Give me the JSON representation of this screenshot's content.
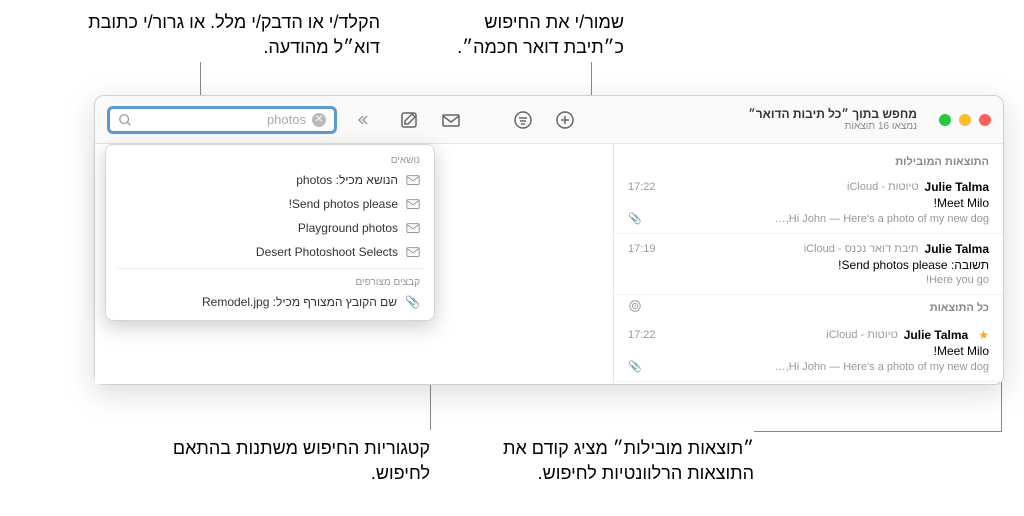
{
  "callouts": {
    "top_left": "הקלד/י או הדבק/י מלל. או גרור/י כתובת דוא״ל מהודעה.",
    "top_right": "שמור/י את החיפוש כ״תיבת דואר חכמה״.",
    "bottom_left": "קטגוריות החיפוש משתנות בהתאם לחיפוש.",
    "bottom_right": "״תוצאות מובילות״ מציג קודם את התוצאות הרלוונטיות לחיפוש."
  },
  "titlebar": {
    "main": "מחפש בתוך ״כל תיבות הדואר״",
    "sub": "נמצאו 16 תוצאות"
  },
  "search": {
    "text": "photos"
  },
  "sections": {
    "top_hits": "התוצאות המובילות",
    "all_results": "כל התוצאות"
  },
  "messages": {
    "m1": {
      "sender": "Julie Talma",
      "folder": "טיוטות - iCloud",
      "time": "17:22",
      "subject": "Meet Milo!",
      "preview": "Hi John — Here's a photo of my new dog,…"
    },
    "m2": {
      "sender": "Julie Talma",
      "folder": "תיבת דואר נכנס - iCloud",
      "time": "17:19",
      "subject_prefix": "תשובה: ",
      "subject": "Send photos please!",
      "preview": "Here you go!"
    },
    "m3": {
      "sender": "Julie Talma",
      "folder": "טיוטות - iCloud",
      "time": "17:22",
      "subject": "Meet Milo!",
      "preview": "Hi John — Here's a photo of my new dog,…"
    }
  },
  "dropdown": {
    "subjects_label": "נושאים",
    "subject_contains_prefix": "הנושא מכיל: ",
    "subject_contains_value": "photos",
    "item2": "Send photos please!",
    "item3": "Playground photos",
    "item4": "Desert Photoshoot Selects",
    "attachments_label": "קבצים מצורפים",
    "attach_prefix": "שם הקובץ המצורף מכיל: ",
    "attach_value": "Remodel.jpg"
  }
}
